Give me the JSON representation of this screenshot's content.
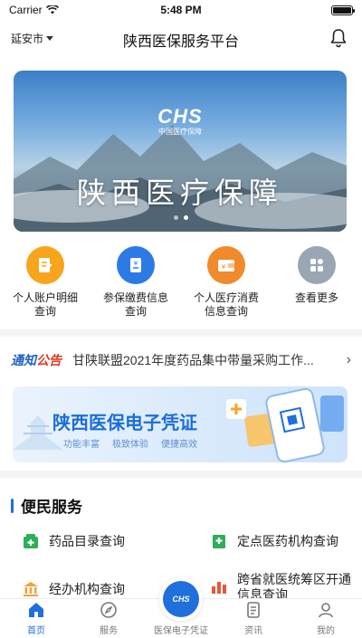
{
  "status_bar": {
    "carrier": "Carrier",
    "time": "5:48 PM"
  },
  "header": {
    "city": "延安市",
    "title": "陕西医保服务平台"
  },
  "banner": {
    "logo": "CHS",
    "logo_sub": "中国医疗保障",
    "headline": "陕西医疗保障"
  },
  "quick_actions": [
    {
      "label": "个人账户明细查询",
      "icon": "document-icon",
      "color": "#f7a51c"
    },
    {
      "label": "参保缴费信息查询",
      "icon": "receipt-icon",
      "color": "#2c7be5"
    },
    {
      "label": "个人医疗消费信息查询",
      "icon": "wallet-icon",
      "color": "#f08a2a"
    },
    {
      "label": "查看更多",
      "icon": "grid-icon",
      "color": "#9aa6b4"
    }
  ],
  "notice": {
    "tag_a": "通知",
    "tag_b": "公告",
    "text": "甘陕联盟2021年度药品集中带量采购工作..."
  },
  "voucher": {
    "title": "陕西医保电子凭证",
    "features": [
      "功能丰富",
      "极致体验",
      "便捷高效"
    ]
  },
  "services": {
    "title": "便民服务",
    "items": [
      {
        "label": "药品目录查询"
      },
      {
        "label": "定点医药机构查询"
      },
      {
        "label": "经办机构查询"
      },
      {
        "label": "跨省就医统筹区开通信息查询"
      }
    ]
  },
  "tabbar": {
    "tabs": [
      {
        "label": "首页"
      },
      {
        "label": "服务"
      },
      {
        "label": "医保电子凭证"
      },
      {
        "label": "资讯"
      },
      {
        "label": "我的"
      }
    ],
    "center_logo": "CHS"
  },
  "colors": {
    "accent": "#1f6fdc",
    "notice_red": "#e0381e"
  }
}
